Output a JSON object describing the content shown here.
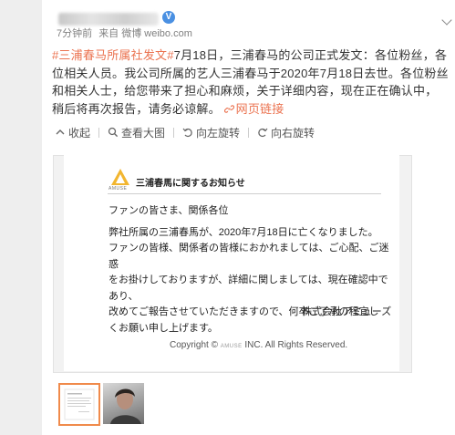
{
  "post": {
    "verified_badge": "V",
    "meta_time": "7分钟前",
    "meta_from": "来自 微博 weibo.com",
    "hashtag": "#三浦春马所属社发文#",
    "body": "7月18日，三浦春马的公司正式发文：各位粉丝，各位相关人员。我公司所属的艺人三浦春马于2020年7月18日去世。各位粉丝和相关人士，给您带来了担心和麻烦，关于详细内容，现在正在确认中，稍后将再次报告，请务必谅解。",
    "link_label": "网页链接"
  },
  "toolbar": {
    "collapse": "收起",
    "view_large": "查看大图",
    "rotate_left": "向左旋转",
    "rotate_right": "向右旋转"
  },
  "document": {
    "logo_text": "AMUSE",
    "title": "三浦春馬に関するお知らせ",
    "greeting": "ファンの皆さま、関係各位",
    "line1": "弊社所属の三浦春馬が、2020年7月18日に亡くなりました。",
    "line2": "ファンの皆様、関係者の皆様におかれましては、ご心配、ご迷惑",
    "line3": "をお掛けしておりますが、詳細に関しましては、現在確認中であり、",
    "line4": "改めてご報告させていただきますので、何卒ご了承の程宜し",
    "line5": "くお願い申し上げます。",
    "company": "株式会社アミューズ",
    "copyright_pre": "Copyright ©",
    "copyright_brand": "AMUSE",
    "copyright_post": "INC. All Rights Reserved."
  },
  "colors": {
    "accent": "#eb7350",
    "verified": "#4a90e2",
    "thumb_border": "#f08a4b"
  }
}
